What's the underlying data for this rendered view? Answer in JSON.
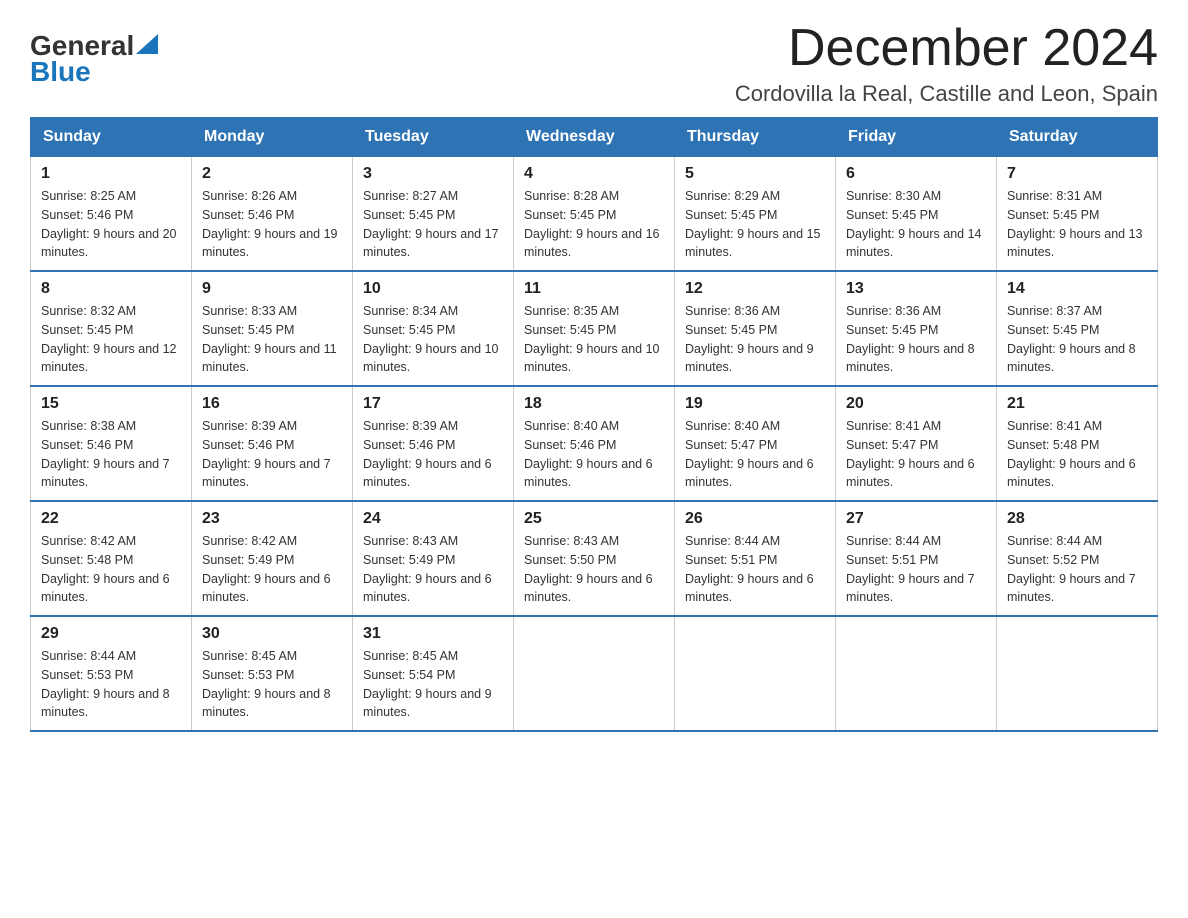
{
  "header": {
    "logo_text_general": "General",
    "logo_text_blue": "Blue",
    "main_title": "December 2024",
    "subtitle": "Cordovilla la Real, Castille and Leon, Spain"
  },
  "calendar": {
    "days_of_week": [
      "Sunday",
      "Monday",
      "Tuesday",
      "Wednesday",
      "Thursday",
      "Friday",
      "Saturday"
    ],
    "weeks": [
      [
        {
          "day": "1",
          "sunrise": "8:25 AM",
          "sunset": "5:46 PM",
          "daylight": "9 hours and 20 minutes."
        },
        {
          "day": "2",
          "sunrise": "8:26 AM",
          "sunset": "5:46 PM",
          "daylight": "9 hours and 19 minutes."
        },
        {
          "day": "3",
          "sunrise": "8:27 AM",
          "sunset": "5:45 PM",
          "daylight": "9 hours and 17 minutes."
        },
        {
          "day": "4",
          "sunrise": "8:28 AM",
          "sunset": "5:45 PM",
          "daylight": "9 hours and 16 minutes."
        },
        {
          "day": "5",
          "sunrise": "8:29 AM",
          "sunset": "5:45 PM",
          "daylight": "9 hours and 15 minutes."
        },
        {
          "day": "6",
          "sunrise": "8:30 AM",
          "sunset": "5:45 PM",
          "daylight": "9 hours and 14 minutes."
        },
        {
          "day": "7",
          "sunrise": "8:31 AM",
          "sunset": "5:45 PM",
          "daylight": "9 hours and 13 minutes."
        }
      ],
      [
        {
          "day": "8",
          "sunrise": "8:32 AM",
          "sunset": "5:45 PM",
          "daylight": "9 hours and 12 minutes."
        },
        {
          "day": "9",
          "sunrise": "8:33 AM",
          "sunset": "5:45 PM",
          "daylight": "9 hours and 11 minutes."
        },
        {
          "day": "10",
          "sunrise": "8:34 AM",
          "sunset": "5:45 PM",
          "daylight": "9 hours and 10 minutes."
        },
        {
          "day": "11",
          "sunrise": "8:35 AM",
          "sunset": "5:45 PM",
          "daylight": "9 hours and 10 minutes."
        },
        {
          "day": "12",
          "sunrise": "8:36 AM",
          "sunset": "5:45 PM",
          "daylight": "9 hours and 9 minutes."
        },
        {
          "day": "13",
          "sunrise": "8:36 AM",
          "sunset": "5:45 PM",
          "daylight": "9 hours and 8 minutes."
        },
        {
          "day": "14",
          "sunrise": "8:37 AM",
          "sunset": "5:45 PM",
          "daylight": "9 hours and 8 minutes."
        }
      ],
      [
        {
          "day": "15",
          "sunrise": "8:38 AM",
          "sunset": "5:46 PM",
          "daylight": "9 hours and 7 minutes."
        },
        {
          "day": "16",
          "sunrise": "8:39 AM",
          "sunset": "5:46 PM",
          "daylight": "9 hours and 7 minutes."
        },
        {
          "day": "17",
          "sunrise": "8:39 AM",
          "sunset": "5:46 PM",
          "daylight": "9 hours and 6 minutes."
        },
        {
          "day": "18",
          "sunrise": "8:40 AM",
          "sunset": "5:46 PM",
          "daylight": "9 hours and 6 minutes."
        },
        {
          "day": "19",
          "sunrise": "8:40 AM",
          "sunset": "5:47 PM",
          "daylight": "9 hours and 6 minutes."
        },
        {
          "day": "20",
          "sunrise": "8:41 AM",
          "sunset": "5:47 PM",
          "daylight": "9 hours and 6 minutes."
        },
        {
          "day": "21",
          "sunrise": "8:41 AM",
          "sunset": "5:48 PM",
          "daylight": "9 hours and 6 minutes."
        }
      ],
      [
        {
          "day": "22",
          "sunrise": "8:42 AM",
          "sunset": "5:48 PM",
          "daylight": "9 hours and 6 minutes."
        },
        {
          "day": "23",
          "sunrise": "8:42 AM",
          "sunset": "5:49 PM",
          "daylight": "9 hours and 6 minutes."
        },
        {
          "day": "24",
          "sunrise": "8:43 AM",
          "sunset": "5:49 PM",
          "daylight": "9 hours and 6 minutes."
        },
        {
          "day": "25",
          "sunrise": "8:43 AM",
          "sunset": "5:50 PM",
          "daylight": "9 hours and 6 minutes."
        },
        {
          "day": "26",
          "sunrise": "8:44 AM",
          "sunset": "5:51 PM",
          "daylight": "9 hours and 6 minutes."
        },
        {
          "day": "27",
          "sunrise": "8:44 AM",
          "sunset": "5:51 PM",
          "daylight": "9 hours and 7 minutes."
        },
        {
          "day": "28",
          "sunrise": "8:44 AM",
          "sunset": "5:52 PM",
          "daylight": "9 hours and 7 minutes."
        }
      ],
      [
        {
          "day": "29",
          "sunrise": "8:44 AM",
          "sunset": "5:53 PM",
          "daylight": "9 hours and 8 minutes."
        },
        {
          "day": "30",
          "sunrise": "8:45 AM",
          "sunset": "5:53 PM",
          "daylight": "9 hours and 8 minutes."
        },
        {
          "day": "31",
          "sunrise": "8:45 AM",
          "sunset": "5:54 PM",
          "daylight": "9 hours and 9 minutes."
        },
        null,
        null,
        null,
        null
      ]
    ]
  }
}
